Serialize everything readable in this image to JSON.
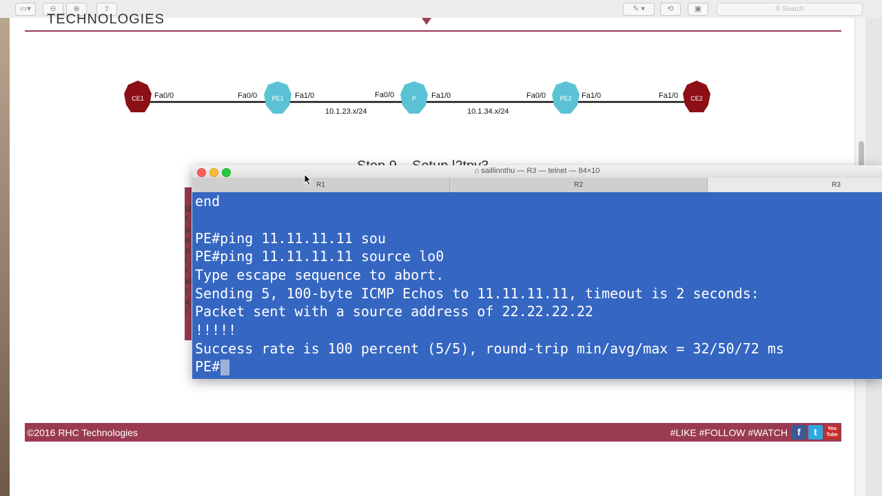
{
  "viewer": {
    "search_placeholder": "Search"
  },
  "slide": {
    "header_title": "TECHNOLOGIES",
    "heading": "Step 9 – Setup l2tpv3",
    "edge_text": [
      "l2",
      "!",
      "p",
      "e",
      "p",
      "i",
      "!",
      "in",
      "!",
      "x",
      "!"
    ],
    "footer_left": "©2016 RHC Technologies",
    "footer_right": "#LIKE #FOLLOW #WATCH",
    "social": {
      "facebook": "f",
      "twitter": "t",
      "youtube": "You Tube"
    }
  },
  "topology": {
    "nodes": [
      "CE1",
      "PE1",
      "P",
      "PE2",
      "CE2"
    ],
    "interfaces": [
      "Fa0/0",
      "Fa0/0",
      "Fa1/0",
      "Fa0/0",
      "Fa1/0",
      "Fa0/0",
      "Fa1/0",
      "Fa1/0"
    ],
    "subnets": [
      "10.1.23.x/24",
      "10.1.34.x/24"
    ],
    "colors": {
      "ce": "#8b0f14",
      "core": "#5bc2d6"
    }
  },
  "terminal": {
    "title": "saillinnthu — R3 — telnet — 84×10",
    "tabs": [
      "R1",
      "R2",
      "R3"
    ],
    "lines": [
      "end",
      "",
      "PE#ping 11.11.11.11 sou",
      "PE#ping 11.11.11.11 source lo0",
      "Type escape sequence to abort.",
      "Sending 5, 100-byte ICMP Echos to 11.11.11.11, timeout is 2 seconds:",
      "Packet sent with a source address of 22.22.22.22",
      "!!!!!",
      "Success rate is 100 percent (5/5), round-trip min/avg/max = 32/50/72 ms"
    ],
    "prompt": "PE#",
    "background": "#3566c2"
  }
}
